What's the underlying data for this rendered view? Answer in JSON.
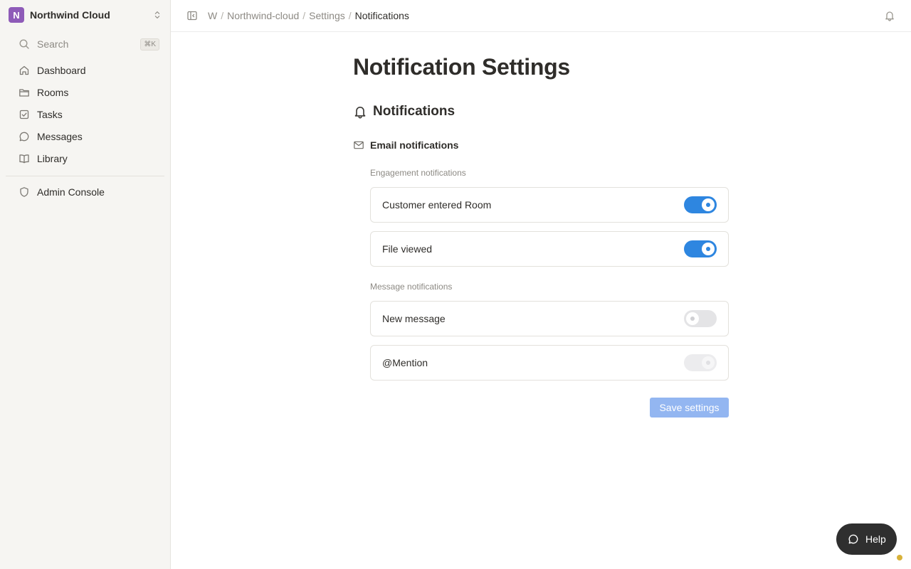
{
  "workspace": {
    "initial": "N",
    "name": "Northwind Cloud",
    "badge_color": "#8e5bb8"
  },
  "search": {
    "label": "Search",
    "shortcut": "⌘K"
  },
  "sidebar": {
    "items": [
      {
        "label": "Dashboard",
        "icon": "home-icon"
      },
      {
        "label": "Rooms",
        "icon": "folder-icon"
      },
      {
        "label": "Tasks",
        "icon": "checkbox-icon"
      },
      {
        "label": "Messages",
        "icon": "chat-bubble-icon"
      },
      {
        "label": "Library",
        "icon": "book-icon"
      }
    ],
    "admin": {
      "label": "Admin Console",
      "icon": "shield-icon"
    }
  },
  "breadcrumb": {
    "items": [
      "W",
      "Northwind-cloud",
      "Settings"
    ],
    "current": "Notifications",
    "separator": "/"
  },
  "page": {
    "title": "Notification Settings",
    "section_title": "Notifications",
    "email_title": "Email notifications"
  },
  "groups": [
    {
      "label": "Engagement notifications",
      "settings": [
        {
          "label": "Customer entered Room",
          "state": "on"
        },
        {
          "label": "File viewed",
          "state": "on"
        }
      ]
    },
    {
      "label": "Message notifications",
      "settings": [
        {
          "label": "New message",
          "state": "off"
        },
        {
          "label": "@Mention",
          "state": "disabled-on"
        }
      ]
    }
  ],
  "actions": {
    "save_label": "Save settings"
  },
  "help": {
    "label": "Help"
  },
  "colors": {
    "accent": "#2e86e0",
    "save_disabled": "#93b6f1",
    "status_dot": "#d8b23a"
  }
}
